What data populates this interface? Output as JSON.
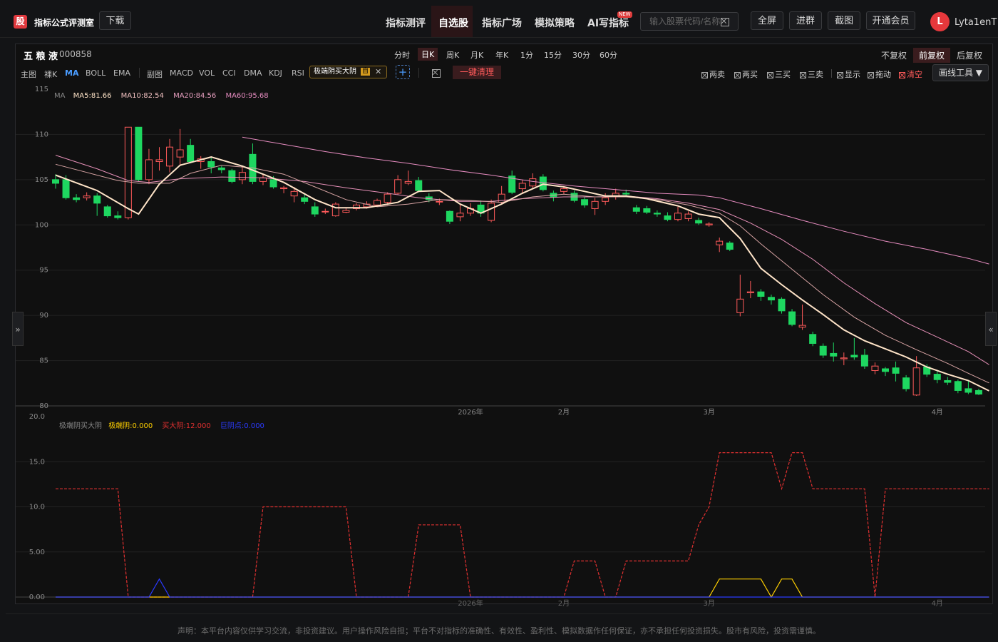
{
  "app": {
    "logo_text": "股",
    "title": "指标公式评测室",
    "download_label": "下载"
  },
  "nav": [
    {
      "label": "指标测评"
    },
    {
      "label": "自选股",
      "active": true
    },
    {
      "label": "指标广场"
    },
    {
      "label": "模拟策略"
    },
    {
      "label": "AI写指标",
      "badge": "NEW"
    }
  ],
  "search": {
    "placeholder": "输入股票代码/名称"
  },
  "header_buttons": {
    "fullscreen": "全屏",
    "join_group": "进群",
    "screenshot": "截图",
    "membership": "开通会员"
  },
  "user": {
    "avatar_letter": "L",
    "name": "Lyta1enT"
  },
  "stock": {
    "name": "五 粮 液",
    "code": "000858"
  },
  "periods": [
    "分时",
    "日K",
    "周K",
    "月K",
    "年K",
    "1分",
    "15分",
    "30分",
    "60分"
  ],
  "active_period": "日K",
  "adjust": [
    "不复权",
    "前复权",
    "后复权"
  ],
  "active_adjust": "前复权",
  "main_indicators": [
    "主图",
    "裸K",
    "MA",
    "BOLL",
    "EMA"
  ],
  "sub_indicators": [
    "副图",
    "MACD",
    "VOL",
    "CCI",
    "DMA",
    "KDJ",
    "RSI"
  ],
  "custom_indicator": {
    "label": "极端阴买大阴",
    "tag": "自"
  },
  "clear_all_label": "一键清理",
  "tools": [
    "两卖",
    "两买",
    "三买",
    "三卖",
    "显示",
    "拖动",
    "清空"
  ],
  "draw_tools_label": "画线工具 ▼",
  "side_tabs": {
    "left": "»",
    "right": "«"
  },
  "ma_legend": {
    "label": "MA",
    "ma5": "MA5:81.66",
    "ma10": "MA10:82.54",
    "ma20": "MA20:84.56",
    "ma60": "MA60:95.68"
  },
  "sub_legend": {
    "name": "极端阴买大阴",
    "s1": "极端阴:0.000",
    "s2": "买大阴:12.000",
    "s3": "巨阴点:0.000"
  },
  "x_labels": [
    "2026年",
    "2月",
    "3月",
    "4月"
  ],
  "colors": {
    "up": "#ff5a5a",
    "down": "#1ed760",
    "ma5": "#ffe4c8",
    "ma10": "#d8a4a4",
    "ma20": "#e690b8",
    "ma60": "#e68cc0",
    "buy": "#e03030",
    "extreme": "#ffd000",
    "big": "#2a3aff",
    "accent": "#e0393e"
  },
  "disclaimer": "声明：本平台内容仅供学习交流，非投资建议。用户操作风险自担；平台不对指标的准确性、有效性、盈利性、模拟数据作任何保证，亦不承担任何投资损失。股市有风险，投资需谨慎。",
  "chart_data": [
    {
      "type": "candlestick",
      "ylim": [
        80,
        115
      ],
      "y_ticks": [
        80,
        85,
        90,
        95,
        100,
        105,
        110,
        115
      ],
      "candles": [
        [
          105,
          104.6,
          105.6,
          104
        ],
        [
          105,
          103,
          105.5,
          102.8
        ],
        [
          103,
          102.8,
          103.4,
          102.5
        ],
        [
          103,
          103.2,
          103.6,
          102.7
        ],
        [
          103.2,
          102.4,
          103.5,
          101
        ],
        [
          102,
          101,
          102.2,
          100.8
        ],
        [
          101,
          100.8,
          101.5,
          100.6
        ],
        [
          100.8,
          110.8,
          110.8,
          100.6
        ],
        [
          110.8,
          105,
          110.8,
          104.8
        ],
        [
          105,
          107.2,
          108.4,
          104.5
        ],
        [
          107,
          107.2,
          108.6,
          106
        ],
        [
          106.5,
          108.6,
          109.5,
          105.8
        ],
        [
          107.5,
          108.3,
          110.6,
          106.5
        ],
        [
          108.8,
          107,
          109.5,
          106.8
        ],
        [
          107,
          107.3,
          107.6,
          106.2
        ],
        [
          107,
          106.4,
          107.5,
          105.7
        ],
        [
          106.3,
          106.1,
          106.5,
          105.7
        ],
        [
          106,
          104.8,
          106.2,
          104.6
        ],
        [
          105,
          105.8,
          106.5,
          104.5
        ],
        [
          107.8,
          104.8,
          109,
          104.5
        ],
        [
          104.8,
          105.2,
          105.6,
          104.4
        ],
        [
          105,
          104.2,
          105.4,
          104
        ],
        [
          104,
          104.1,
          104.3,
          103.5
        ],
        [
          103.2,
          103.7,
          104.2,
          102.5
        ],
        [
          103,
          102.6,
          103.5,
          102.3
        ],
        [
          102,
          101.2,
          102.5,
          100.9
        ],
        [
          101.5,
          101.5,
          101.8,
          101.2
        ],
        [
          101,
          102.3,
          102.5,
          100.9
        ],
        [
          101.4,
          101.6,
          101.9,
          101.3
        ],
        [
          101.8,
          102.2,
          102.4,
          101.6
        ],
        [
          102,
          102.3,
          102.6,
          101.8
        ],
        [
          102.2,
          102.7,
          102.9,
          102
        ],
        [
          102.5,
          103.4,
          103.6,
          102.2
        ],
        [
          103.5,
          105,
          105.5,
          103.3
        ],
        [
          104.6,
          104.8,
          106,
          104.4
        ],
        [
          104.9,
          103.8,
          105.3,
          103.6
        ],
        [
          103.1,
          102.8,
          103.5,
          102.5
        ],
        [
          102.6,
          102.6,
          102.9,
          102.2
        ],
        [
          101.5,
          100.4,
          101.6,
          100.1
        ],
        [
          100.9,
          101.3,
          102.3,
          100.4
        ],
        [
          101.3,
          101.8,
          102.4,
          101
        ],
        [
          102.2,
          101.3,
          102.7,
          100.9
        ],
        [
          100.5,
          102.4,
          102.8,
          100.3
        ],
        [
          102.5,
          103.4,
          104.3,
          102.3
        ],
        [
          105.4,
          103.6,
          106,
          103.4
        ],
        [
          104,
          104.6,
          105,
          103.5
        ],
        [
          104.3,
          105.1,
          105.7,
          104
        ],
        [
          105.3,
          103.9,
          105.6,
          103.7
        ],
        [
          103.5,
          103.1,
          103.8,
          102.6
        ],
        [
          103.7,
          104,
          104.3,
          103.4
        ],
        [
          103.5,
          102.7,
          103.8,
          102.5
        ],
        [
          102.8,
          102.2,
          103.1,
          101.9
        ],
        [
          101.8,
          102.6,
          103,
          101.1
        ],
        [
          102.6,
          103,
          103.5,
          102.2
        ],
        [
          103.1,
          103.5,
          104,
          102.8
        ],
        [
          103.5,
          103.4,
          103.9,
          103.2
        ],
        [
          101.9,
          101.5,
          102.2,
          101.2
        ],
        [
          101.8,
          101.4,
          102.1,
          101.2
        ],
        [
          101.3,
          101.2,
          101.6,
          100.9
        ],
        [
          101,
          100.6,
          101.4,
          100.4
        ],
        [
          100.6,
          101.3,
          102,
          100.4
        ],
        [
          100.7,
          101.2,
          101.5,
          100.4
        ],
        [
          100.5,
          100.2,
          100.8,
          100
        ],
        [
          100,
          100.1,
          100.3,
          99.8
        ],
        [
          97.8,
          98.2,
          98.6,
          97
        ],
        [
          98,
          97.3,
          98.2,
          97.1
        ],
        [
          90.3,
          91.8,
          94.5,
          89.9
        ],
        [
          92.5,
          92.6,
          93.8,
          91.9
        ],
        [
          92.6,
          92.1,
          92.9,
          91.6
        ],
        [
          92,
          91.7,
          92.3,
          91.2
        ],
        [
          91.8,
          90.5,
          92,
          90.2
        ],
        [
          90.4,
          89,
          90.7,
          88.8
        ],
        [
          88.7,
          88.9,
          91.2,
          88.4
        ],
        [
          87.9,
          86.9,
          88.2,
          86.6
        ],
        [
          86.6,
          85.6,
          86.9,
          85.3
        ],
        [
          85.8,
          85.5,
          87,
          84.9
        ],
        [
          85.2,
          85.3,
          85.9,
          84.5
        ],
        [
          85.6,
          85.4,
          87.5,
          85.1
        ],
        [
          85.6,
          84.4,
          86.3,
          84.1
        ],
        [
          83.9,
          84.4,
          84.8,
          83.5
        ],
        [
          84.1,
          83.8,
          84.3,
          83.3
        ],
        [
          84.2,
          83.6,
          84.9,
          82.7
        ],
        [
          83.1,
          81.9,
          83.4,
          81.6
        ],
        [
          81.2,
          84.2,
          85.5,
          81.1
        ],
        [
          84.3,
          83.5,
          84.6,
          83.2
        ],
        [
          83.5,
          82.9,
          83.9,
          82.5
        ],
        [
          82.8,
          82.6,
          83.2,
          82.3
        ],
        [
          82.7,
          81.7,
          82.9,
          81.4
        ],
        [
          81.9,
          81.5,
          82.8,
          81.3
        ],
        [
          81.7,
          81.3,
          81.9,
          81.2
        ]
      ],
      "ma5": [
        [
          0,
          105.5
        ],
        [
          4,
          103.8
        ],
        [
          7,
          101.8
        ],
        [
          8,
          101.2
        ],
        [
          10,
          104.5
        ],
        [
          12,
          106.6
        ],
        [
          15,
          107.5
        ],
        [
          18,
          106.5
        ],
        [
          20,
          105.6
        ],
        [
          22,
          104.7
        ],
        [
          25,
          102.8
        ],
        [
          27,
          101.9
        ],
        [
          30,
          101.9
        ],
        [
          33,
          102.5
        ],
        [
          35,
          103.7
        ],
        [
          37,
          103.8
        ],
        [
          39,
          102.3
        ],
        [
          41,
          101.3
        ],
        [
          43,
          102.3
        ],
        [
          45,
          103.5
        ],
        [
          47,
          104.5
        ],
        [
          49,
          104.2
        ],
        [
          51,
          103.7
        ],
        [
          53,
          103.2
        ],
        [
          55,
          103.2
        ],
        [
          57,
          102.9
        ],
        [
          60,
          102.1
        ],
        [
          62,
          101.2
        ],
        [
          64,
          100.8
        ],
        [
          66,
          98.5
        ],
        [
          68,
          95.2
        ],
        [
          70,
          93.4
        ],
        [
          72,
          91.7
        ],
        [
          74,
          90.1
        ],
        [
          76,
          88.4
        ],
        [
          78,
          87.2
        ],
        [
          80,
          86.3
        ],
        [
          82,
          85.4
        ],
        [
          84,
          84.3
        ],
        [
          86,
          83.5
        ],
        [
          88,
          82.8
        ],
        [
          90,
          81.66
        ]
      ],
      "ma10": [
        [
          0,
          106.7
        ],
        [
          3,
          105.8
        ],
        [
          6,
          104.9
        ],
        [
          8,
          104.6
        ],
        [
          11,
          104.6
        ],
        [
          13,
          105.7
        ],
        [
          16,
          106.6
        ],
        [
          19,
          106.3
        ],
        [
          22,
          105.6
        ],
        [
          25,
          104.2
        ],
        [
          28,
          102.8
        ],
        [
          31,
          102
        ],
        [
          34,
          102.3
        ],
        [
          37,
          102.8
        ],
        [
          40,
          102.7
        ],
        [
          43,
          102.5
        ],
        [
          46,
          103.1
        ],
        [
          49,
          103.4
        ],
        [
          52,
          103.1
        ],
        [
          55,
          103.1
        ],
        [
          58,
          102.8
        ],
        [
          61,
          102.2
        ],
        [
          64,
          101.3
        ],
        [
          66,
          99.9
        ],
        [
          68,
          97.9
        ],
        [
          71,
          95.1
        ],
        [
          74,
          92.3
        ],
        [
          77,
          89.8
        ],
        [
          80,
          87.8
        ],
        [
          83,
          86.2
        ],
        [
          86,
          84.7
        ],
        [
          88,
          83.6
        ],
        [
          90,
          82.54
        ]
      ],
      "ma20": [
        [
          0,
          107.7
        ],
        [
          4,
          106.2
        ],
        [
          7,
          104.9
        ],
        [
          9,
          104.7
        ],
        [
          12,
          105.1
        ],
        [
          16,
          105.3
        ],
        [
          20,
          105.2
        ],
        [
          24,
          104.8
        ],
        [
          28,
          104.1
        ],
        [
          32,
          103.5
        ],
        [
          35,
          103
        ],
        [
          39,
          102.6
        ],
        [
          42,
          102.6
        ],
        [
          45,
          102.9
        ],
        [
          49,
          103.1
        ],
        [
          52,
          103.1
        ],
        [
          55,
          103.2
        ],
        [
          58,
          102.9
        ],
        [
          61,
          102.4
        ],
        [
          64,
          101.7
        ],
        [
          67,
          100.2
        ],
        [
          70,
          98.4
        ],
        [
          73,
          96.2
        ],
        [
          76,
          93.6
        ],
        [
          79,
          91.3
        ],
        [
          82,
          89.2
        ],
        [
          85,
          87.6
        ],
        [
          88,
          86
        ],
        [
          90,
          84.56
        ]
      ],
      "ma60": [
        [
          18,
          109.7
        ],
        [
          22,
          108.9
        ],
        [
          26,
          108.1
        ],
        [
          30,
          107.4
        ],
        [
          34,
          106.8
        ],
        [
          38,
          106.1
        ],
        [
          42,
          105.5
        ],
        [
          46,
          104.8
        ],
        [
          50,
          104.3
        ],
        [
          54,
          103.9
        ],
        [
          58,
          103.5
        ],
        [
          62,
          103.3
        ],
        [
          64,
          103
        ],
        [
          68,
          101.8
        ],
        [
          72,
          100.5
        ],
        [
          76,
          99.3
        ],
        [
          80,
          98.2
        ],
        [
          84,
          97.3
        ],
        [
          88,
          96.3
        ],
        [
          90,
          95.68
        ]
      ],
      "x_tick_index": {
        "2026年": 40,
        "2月": 49,
        "3月": 63,
        "4月": 85
      }
    },
    {
      "type": "line",
      "ylim": [
        0,
        20
      ],
      "y_ticks": [
        "0.00",
        "5.00",
        "10.0",
        "15.0",
        "20.0"
      ],
      "series": [
        {
          "name": "买大阴",
          "style": "dashed",
          "points": [
            [
              0,
              12
            ],
            [
              6,
              12
            ],
            [
              7,
              0
            ],
            [
              19,
              0
            ],
            [
              20,
              10
            ],
            [
              28,
              10
            ],
            [
              29,
              0
            ],
            [
              34,
              0
            ],
            [
              35,
              8
            ],
            [
              39,
              8
            ],
            [
              40,
              0
            ],
            [
              49,
              0
            ],
            [
              50,
              4
            ],
            [
              52,
              4
            ],
            [
              53,
              0
            ],
            [
              54,
              0
            ],
            [
              55,
              4
            ],
            [
              61,
              4
            ],
            [
              62,
              8
            ],
            [
              63,
              10
            ],
            [
              64,
              16
            ],
            [
              69,
              16
            ],
            [
              70,
              12
            ],
            [
              71,
              16
            ],
            [
              72,
              16
            ],
            [
              73,
              12
            ],
            [
              78,
              12
            ],
            [
              79,
              0
            ],
            [
              80,
              12
            ],
            [
              90,
              12
            ]
          ]
        },
        {
          "name": "极端阴",
          "style": "solid",
          "points": [
            [
              0,
              0
            ],
            [
              63,
              0
            ],
            [
              64,
              2
            ],
            [
              68,
              2
            ],
            [
              69,
              0
            ],
            [
              70,
              2
            ],
            [
              71,
              2
            ],
            [
              72,
              0
            ],
            [
              90,
              0
            ]
          ]
        },
        {
          "name": "巨阴点",
          "style": "solid",
          "points": [
            [
              0,
              0
            ],
            [
              9,
              0
            ],
            [
              10,
              2
            ],
            [
              11,
              0
            ],
            [
              90,
              0
            ]
          ]
        }
      ],
      "x_tick_index": {
        "2026年": 40,
        "2月": 49,
        "3月": 63,
        "4月": 85
      }
    }
  ]
}
